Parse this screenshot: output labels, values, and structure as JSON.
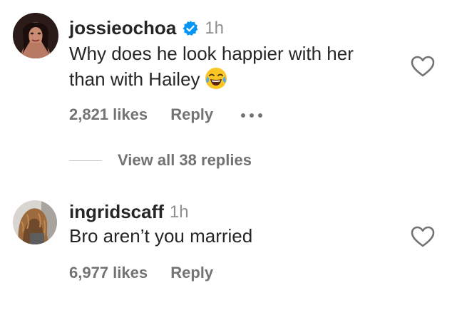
{
  "comments": [
    {
      "username": "jossieochoa",
      "time": "1h",
      "verified": true,
      "text_line1": "Why does he look happier with her",
      "text_line2": "than with Hailey",
      "emoji": "face-with-tears-of-joy",
      "likes": "2,821 likes",
      "reply": "Reply"
    },
    {
      "username": "ingridscaff",
      "time": "1h",
      "verified": false,
      "text_line1": "Bro aren’t you married",
      "likes": "6,977 likes",
      "reply": "Reply"
    }
  ],
  "view_replies": "View all 38 replies",
  "colors": {
    "text": "#262626",
    "secondary": "#737373",
    "time": "#8e8e8e",
    "verified": "#0095f6"
  },
  "icons": {
    "like": "heart-icon",
    "more": "more-options-icon",
    "verified": "verified-badge-icon"
  }
}
